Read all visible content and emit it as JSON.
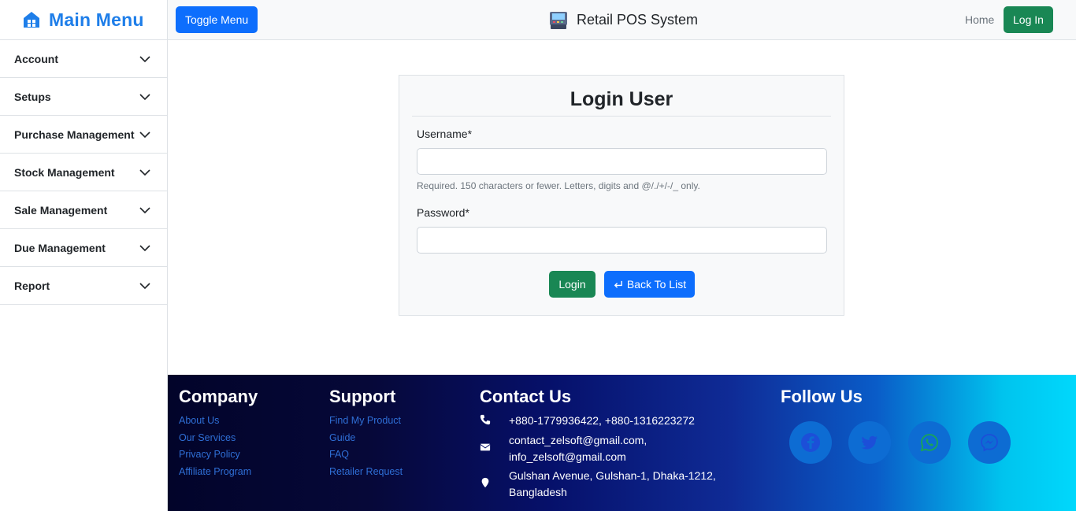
{
  "sidebar": {
    "title": "Main Menu",
    "items": [
      {
        "label": "Account"
      },
      {
        "label": "Setups"
      },
      {
        "label": "Purchase Management"
      },
      {
        "label": "Stock Management"
      },
      {
        "label": "Sale Management"
      },
      {
        "label": "Due Management"
      },
      {
        "label": "Report"
      }
    ]
  },
  "topbar": {
    "toggle_label": "Toggle Menu",
    "app_title": "Retail POS System",
    "home_label": "Home",
    "login_label": "Log In"
  },
  "login_form": {
    "title": "Login User",
    "username_label": "Username*",
    "username_value": "",
    "username_help": "Required. 150 characters or fewer. Letters, digits and @/./+/-/_ only.",
    "password_label": "Password*",
    "password_value": "",
    "login_button": "Login",
    "back_button": "Back To List"
  },
  "footer": {
    "company": {
      "heading": "Company",
      "links": [
        "About Us",
        "Our Services",
        "Privacy Policy",
        "Affiliate Program"
      ]
    },
    "support": {
      "heading": "Support",
      "links": [
        "Find My Product",
        "Guide",
        "FAQ",
        "Retailer Request"
      ]
    },
    "contact": {
      "heading": "Contact Us",
      "phone": "+880-1779936422, +880-1316223272",
      "email_line1": "contact_zelsoft@gmail.com,",
      "email_line2": "info_zelsoft@gmail.com",
      "address_line1": "Gulshan Avenue, Gulshan-1, Dhaka-1212,",
      "address_line2": "Bangladesh"
    },
    "follow": {
      "heading": "Follow Us",
      "icons": [
        "facebook-icon",
        "twitter-icon",
        "whatsapp-icon",
        "messenger-icon"
      ]
    }
  },
  "colors": {
    "primary": "#0d6efd",
    "success": "#198754",
    "brand": "#1e7ee9"
  }
}
